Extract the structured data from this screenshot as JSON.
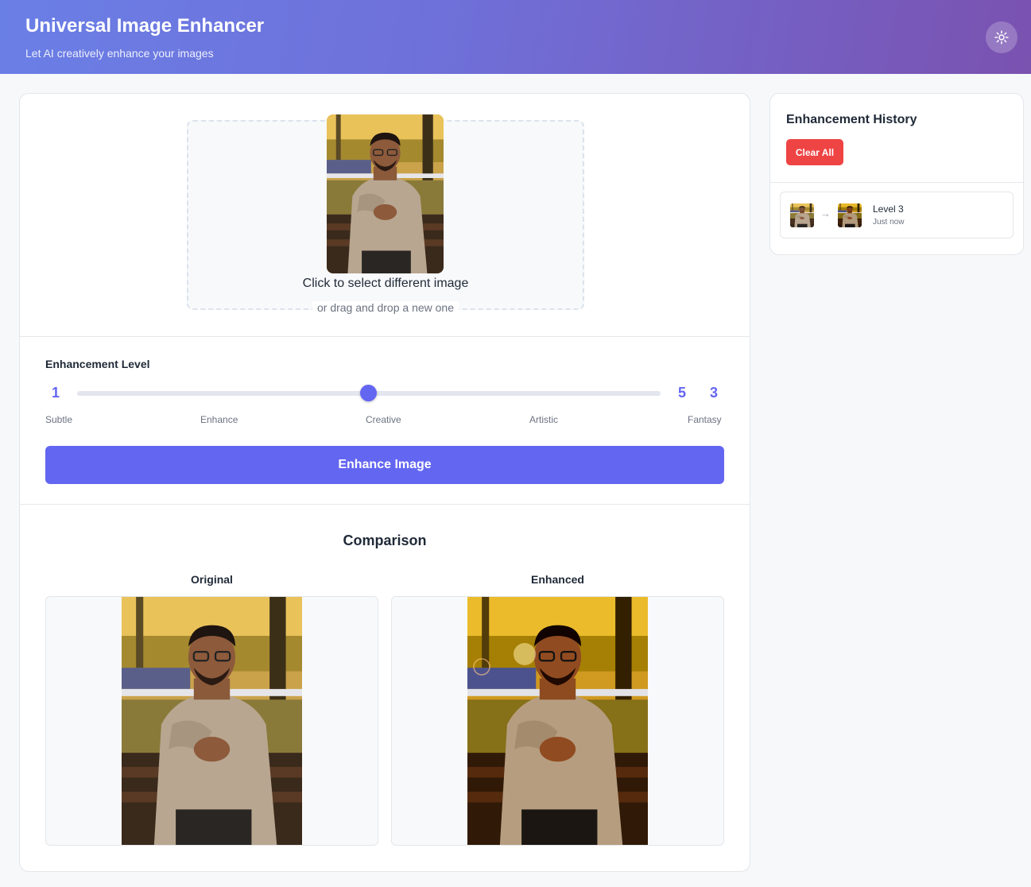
{
  "header": {
    "title": "Universal Image Enhancer",
    "subtitle": "Let AI creatively enhance your images",
    "theme_icon": "sun-icon"
  },
  "upload": {
    "title": "Click to select different image",
    "subtitle": "or drag and drop a new one"
  },
  "enhancement": {
    "label": "Enhancement Level",
    "min": "1",
    "max": "5",
    "current": "3",
    "value": 3,
    "ticks": [
      "Subtle",
      "Enhance",
      "Creative",
      "Artistic",
      "Fantasy"
    ],
    "button_label": "Enhance Image"
  },
  "comparison": {
    "title": "Comparison",
    "original_label": "Original",
    "enhanced_label": "Enhanced"
  },
  "history": {
    "title": "Enhancement History",
    "clear_label": "Clear All",
    "items": [
      {
        "level": "Level 3",
        "time": "Just now"
      }
    ]
  },
  "colors": {
    "accent": "#6366f1",
    "danger": "#ef4444",
    "header_from": "#6a7fe6",
    "header_to": "#7a52b0"
  }
}
